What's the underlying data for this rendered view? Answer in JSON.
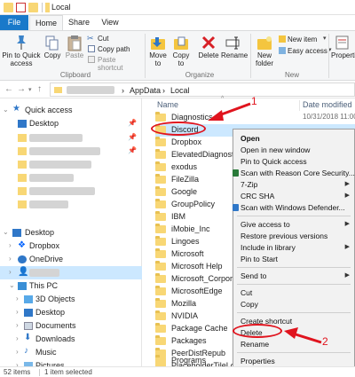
{
  "window": {
    "title": "Local",
    "icons": [
      "folder-icon",
      "checkbox-icon",
      "folder-icon"
    ]
  },
  "ribbon": {
    "tabs": {
      "file": "File",
      "home": "Home",
      "share": "Share",
      "view": "View"
    },
    "clipboard": {
      "pin": "Pin to Quick access",
      "copy": "Copy",
      "paste": "Paste",
      "cut": "Cut",
      "copy_path": "Copy path",
      "paste_shortcut": "Paste shortcut",
      "label": "Clipboard"
    },
    "organize": {
      "move_to": "Move to",
      "copy_to": "Copy to",
      "delete": "Delete",
      "rename": "Rename",
      "label": "Organize"
    },
    "new": {
      "new_folder": "New folder",
      "new_item": "New item",
      "easy_access": "Easy access",
      "label": "New"
    },
    "open": {
      "properties": "Properties"
    }
  },
  "address": {
    "crumbs": [
      "AppData",
      "Local"
    ],
    "separator": "›"
  },
  "nav": {
    "quick_access": "Quick access",
    "desktop": "Desktop",
    "desktop_root": "Desktop",
    "dropbox": "Dropbox",
    "onedrive": "OneDrive",
    "this_pc": "This PC",
    "objects_3d": "3D Objects",
    "desktop_pc": "Desktop",
    "documents": "Documents",
    "downloads": "Downloads",
    "music": "Music",
    "pictures": "Pictures"
  },
  "columns": {
    "name": "Name",
    "date_modified": "Date modified"
  },
  "files": [
    {
      "name": "Diagnostics",
      "date": "10/31/2018 11:00"
    },
    {
      "name": "Discord",
      "date": ""
    },
    {
      "name": "Dropbox",
      "date": ""
    },
    {
      "name": "ElevatedDiagnost",
      "date": ""
    },
    {
      "name": "exodus",
      "date": ""
    },
    {
      "name": "FileZilla",
      "date": ""
    },
    {
      "name": "Google",
      "date": ""
    },
    {
      "name": "GroupPolicy",
      "date": ""
    },
    {
      "name": "IBM",
      "date": ""
    },
    {
      "name": "iMobie_Inc",
      "date": ""
    },
    {
      "name": "Lingoes",
      "date": ""
    },
    {
      "name": "Microsoft",
      "date": ""
    },
    {
      "name": "Microsoft Help",
      "date": ""
    },
    {
      "name": "Microsoft_Corpor",
      "date": ""
    },
    {
      "name": "MicrosoftEdge",
      "date": ""
    },
    {
      "name": "Mozilla",
      "date": ""
    },
    {
      "name": "NVIDIA",
      "date": ""
    },
    {
      "name": "Package Cache",
      "date": ""
    },
    {
      "name": "Packages",
      "date": ""
    },
    {
      "name": "PeerDistRepub",
      "date": ""
    },
    {
      "name": "PlaceholderTileLo",
      "date": ""
    },
    {
      "name": "Programs",
      "date": ""
    }
  ],
  "context_menu": {
    "open": "Open",
    "open_new_window": "Open in new window",
    "pin_quick_access": "Pin to Quick access",
    "zip": "7-Zip",
    "crc": "CRC SHA",
    "scan_reason": "Scan with Reason Core Security...",
    "scan_defender": "Scan with Windows Defender...",
    "give_access": "Give access to",
    "restore": "Restore previous versions",
    "include_library": "Include in library",
    "pin_start": "Pin to Start",
    "send_to": "Send to",
    "cut": "Cut",
    "copy": "Copy",
    "create_shortcut": "Create shortcut",
    "delete": "Delete",
    "rename": "Rename",
    "properties": "Properties"
  },
  "status": {
    "count": "52 items",
    "selected": "1 item selected"
  },
  "annotations": {
    "step1": "1",
    "step2": "2"
  },
  "colors": {
    "accent": "#1979ca",
    "annotation": "#e0141e",
    "folder": "#f8d775",
    "selection": "#cce8ff"
  }
}
